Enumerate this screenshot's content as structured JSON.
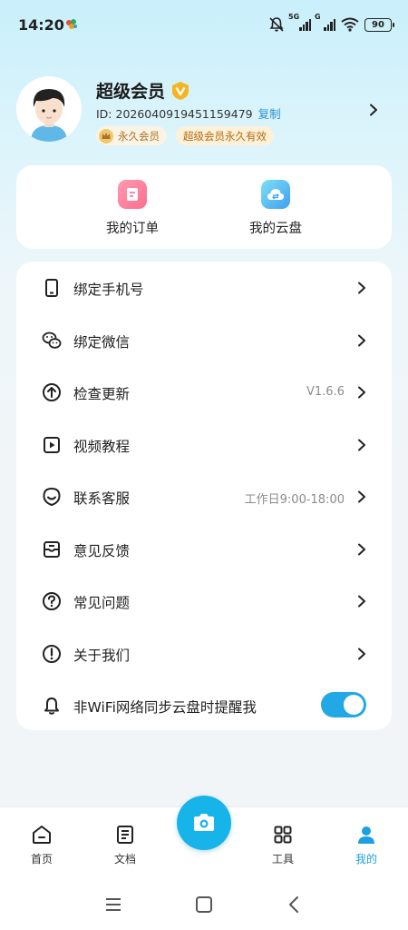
{
  "status_bar": {
    "time": "14:20",
    "network_5g": "5G",
    "network_g": "G",
    "battery": "90",
    "app_icon": "colorful-flower-icon",
    "icons": [
      "bell-muted-icon",
      "signal-icon",
      "signal-icon",
      "wifi-icon",
      "battery-icon"
    ]
  },
  "profile": {
    "name": "超级会员",
    "vip_icon": "gold-v-badge-icon",
    "id_text": "ID: 2026040919451159479",
    "copy_label": "复制",
    "tag_forever": "永久会员",
    "tag_super": "超级会员永久有效",
    "avatar": "cartoon-avatar-icon"
  },
  "quick_actions": [
    {
      "label": "我的订单",
      "icon": "order-icon",
      "color": "#fb6d8f"
    },
    {
      "label": "我的云盘",
      "icon": "cloud-disk-icon",
      "color": "#3f9ff0"
    }
  ],
  "menu": [
    {
      "label": "绑定手机号",
      "icon": "phone-icon",
      "value": ""
    },
    {
      "label": "绑定微信",
      "icon": "wechat-icon",
      "value": ""
    },
    {
      "label": "检查更新",
      "icon": "update-icon",
      "value": "V1.6.6"
    },
    {
      "label": "视频教程",
      "icon": "video-icon",
      "value": ""
    },
    {
      "label": "联系客服",
      "icon": "customer-service-icon",
      "value": "工作日9:00-18:00"
    },
    {
      "label": "意见反馈",
      "icon": "feedback-icon",
      "value": ""
    },
    {
      "label": "常见问题",
      "icon": "question-icon",
      "value": ""
    },
    {
      "label": "关于我们",
      "icon": "info-icon",
      "value": ""
    }
  ],
  "wifi_reminder": {
    "label": "非WiFi网络同步云盘时提醒我",
    "icon": "bell-icon",
    "enabled": true
  },
  "bottom_nav": [
    {
      "label": "首页",
      "icon": "home-icon",
      "active": false
    },
    {
      "label": "文档",
      "icon": "document-icon",
      "active": false
    },
    {
      "label": "工具",
      "icon": "grid-icon",
      "active": false
    },
    {
      "label": "我的",
      "icon": "person-icon",
      "active": true
    }
  ],
  "colors": {
    "accent": "#1e9fe0",
    "camera": "#17b4ea",
    "toggle_on": "#23a8e6",
    "gold": "#b36a16"
  }
}
